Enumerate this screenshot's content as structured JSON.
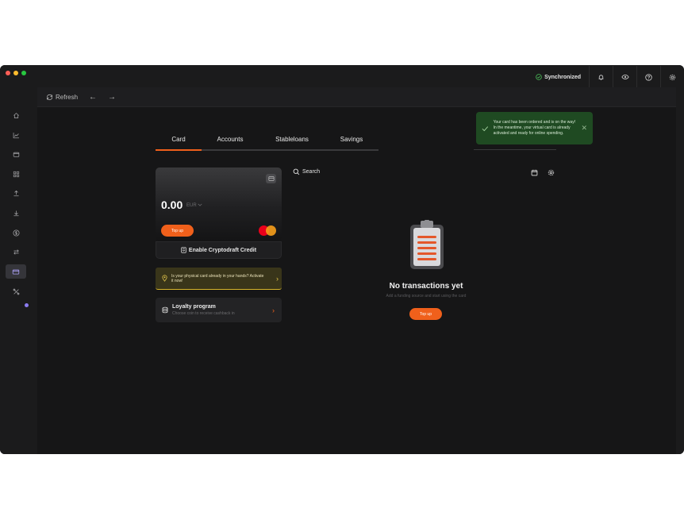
{
  "status": {
    "sync_label": "Synchronized"
  },
  "toolbar": {
    "refresh_label": "Refresh",
    "back_icon": "←",
    "forward_icon": "→"
  },
  "tabs": [
    {
      "label": "Card",
      "active": true
    },
    {
      "label": "Accounts",
      "active": false
    },
    {
      "label": "Stableloans",
      "active": false
    },
    {
      "label": "Savings",
      "active": false
    }
  ],
  "toast": {
    "message": "Your card has been ordered and is on the way! In the meantime, your virtual card is already activated and ready for online spending.",
    "close_icon": "✕"
  },
  "card": {
    "balance": "0.00",
    "currency": "EUR",
    "topup_label": "Top up"
  },
  "credit": {
    "label": "Enable Cryptodraft Credit"
  },
  "notice": {
    "text": "Is your physical card already in your hands? Activate it now!",
    "chevron": "›"
  },
  "loyalty": {
    "title": "Loyalty program",
    "subtitle": "Choose coin to receive cashback in",
    "chevron": "›"
  },
  "search": {
    "label": "Search"
  },
  "empty": {
    "title": "No transactions yet",
    "subtitle": "Add a funding source and start using the card",
    "button": "Top up"
  },
  "colors": {
    "accent": "#f0601b",
    "success_bg": "#1f4a22",
    "warning": "#d8b62b"
  }
}
